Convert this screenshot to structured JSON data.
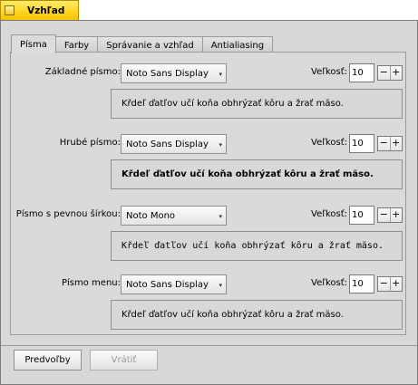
{
  "window": {
    "title": "Vzhľad"
  },
  "tabs": [
    {
      "label": "Písma"
    },
    {
      "label": "Farby"
    },
    {
      "label": "Správanie a vzhľad"
    },
    {
      "label": "Antialiasing"
    }
  ],
  "rows": [
    {
      "label": "Základné písmo:",
      "font": "Noto Sans Display",
      "size_label": "Veľkosť:",
      "size": "10",
      "preview": "Křdeľ ďatľov učí koňa obhrýzať kôru a žrať mäso."
    },
    {
      "label": "Hrubé písmo:",
      "font": "Noto Sans Display",
      "size_label": "Veľkosť:",
      "size": "10",
      "preview": "Křdeľ ďatľov učí koňa obhrýzať kôru a žrať mäso."
    },
    {
      "label": "Písmo s pevnou šírkou:",
      "font": "Noto Mono",
      "size_label": "Veľkosť:",
      "size": "10",
      "preview": "Křdeľ ďatľov učí koňa obhrýzať kôru a žrať mäso."
    },
    {
      "label": "Písmo menu:",
      "font": "Noto Sans Display",
      "size_label": "Veľkosť:",
      "size": "10",
      "preview": "Křdeľ ďatľov učí koňa obhrýzať kôru a žrať mäso."
    }
  ],
  "stepper": {
    "minus": "−",
    "plus": "+"
  },
  "select_arrow": "▾",
  "buttons": {
    "defaults": "Predvoľby",
    "revert": "Vrátiť"
  }
}
